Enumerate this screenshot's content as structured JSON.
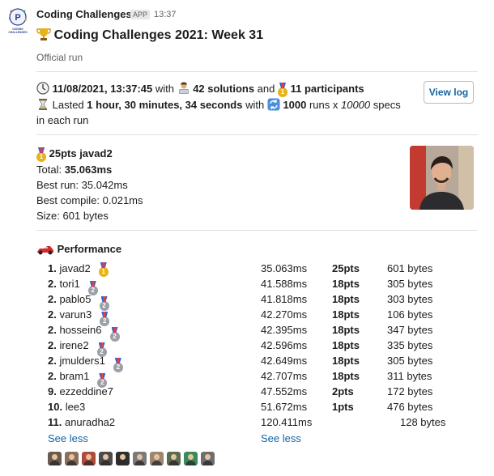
{
  "header": {
    "app_name": "Coding Challenges",
    "app_badge": "APP",
    "time": "13:37",
    "logo_text": "CODING CHALLENGES",
    "title": "Coding Challenges 2021: Week 31",
    "subtitle": "Official run"
  },
  "run": {
    "datetime": "11/08/2021, 13:37:45",
    "with_label": " with ",
    "solutions": "42 solutions",
    "and_label": " and ",
    "participants": "11 participants",
    "lasted_label": "Lasted ",
    "duration": "1 hour, 30 minutes, 34 seconds",
    "with_label2": " with ",
    "runs": "1000",
    "runs_suffix": " runs x ",
    "specs_num": "10000",
    "specs_suffix": " specs",
    "in_each_run": "in each run",
    "view_log": "View log"
  },
  "winner": {
    "headline": "25pts javad2",
    "total_label": "Total: ",
    "total_value": "35.063ms",
    "best_run": "Best run: 35.042ms",
    "best_compile": "Best compile: 0.021ms",
    "size": "Size: 601 bytes"
  },
  "performance": {
    "title": "Performance",
    "rows": [
      {
        "rank": "1.",
        "name": "javad2",
        "medal": "gold",
        "time": "35.063ms",
        "pts": "25pts",
        "size": "601 bytes"
      },
      {
        "rank": "2.",
        "name": "tori1",
        "medal": "silver",
        "time": "41.588ms",
        "pts": "18pts",
        "size": "305 bytes"
      },
      {
        "rank": "2.",
        "name": "pablo5",
        "medal": "silver",
        "time": "41.818ms",
        "pts": "18pts",
        "size": "303 bytes"
      },
      {
        "rank": "2.",
        "name": "varun3",
        "medal": "silver",
        "time": "42.270ms",
        "pts": "18pts",
        "size": "106 bytes"
      },
      {
        "rank": "2.",
        "name": "hossein6",
        "medal": "silver",
        "time": "42.395ms",
        "pts": "18pts",
        "size": "347 bytes"
      },
      {
        "rank": "2.",
        "name": "irene2",
        "medal": "silver",
        "time": "42.596ms",
        "pts": "18pts",
        "size": "335 bytes"
      },
      {
        "rank": "2.",
        "name": "jmulders1",
        "medal": "silver",
        "time": "42.649ms",
        "pts": "18pts",
        "size": "305 bytes"
      },
      {
        "rank": "2.",
        "name": "bram1",
        "medal": "silver",
        "time": "42.707ms",
        "pts": "18pts",
        "size": "311 bytes"
      },
      {
        "rank": "9.",
        "name": "ezzeddine7",
        "medal": "",
        "time": "47.552ms",
        "pts": "2pts",
        "size": "172 bytes"
      },
      {
        "rank": "10.",
        "name": "lee3",
        "medal": "",
        "time": "51.672ms",
        "pts": "1pts",
        "size": "476 bytes"
      },
      {
        "rank": "11.",
        "name": "anuradha2",
        "medal": "",
        "time": "120.411ms",
        "pts": "",
        "size": "128 bytes"
      }
    ],
    "see_less_left": "See less",
    "see_less_right": "See less"
  },
  "colors": {
    "link": "#1264a3",
    "text": "#1d1c1d",
    "muted": "#616061",
    "gold": "#e8b21a",
    "silver": "#9aa0a6"
  },
  "icons": [
    "trophy-icon",
    "clock-icon",
    "technologist-icon",
    "medal-icon",
    "hourglass-icon",
    "repeat-icon",
    "race-car-icon",
    "avatar-icon"
  ],
  "avatar_colors": [
    "#6b5b4e",
    "#8a6f5a",
    "#b04a3a",
    "#4b4b4b",
    "#2e2e2e",
    "#7a7a7a",
    "#9c8670",
    "#5a6b4e",
    "#3c8a5a",
    "#6e6e6e"
  ]
}
